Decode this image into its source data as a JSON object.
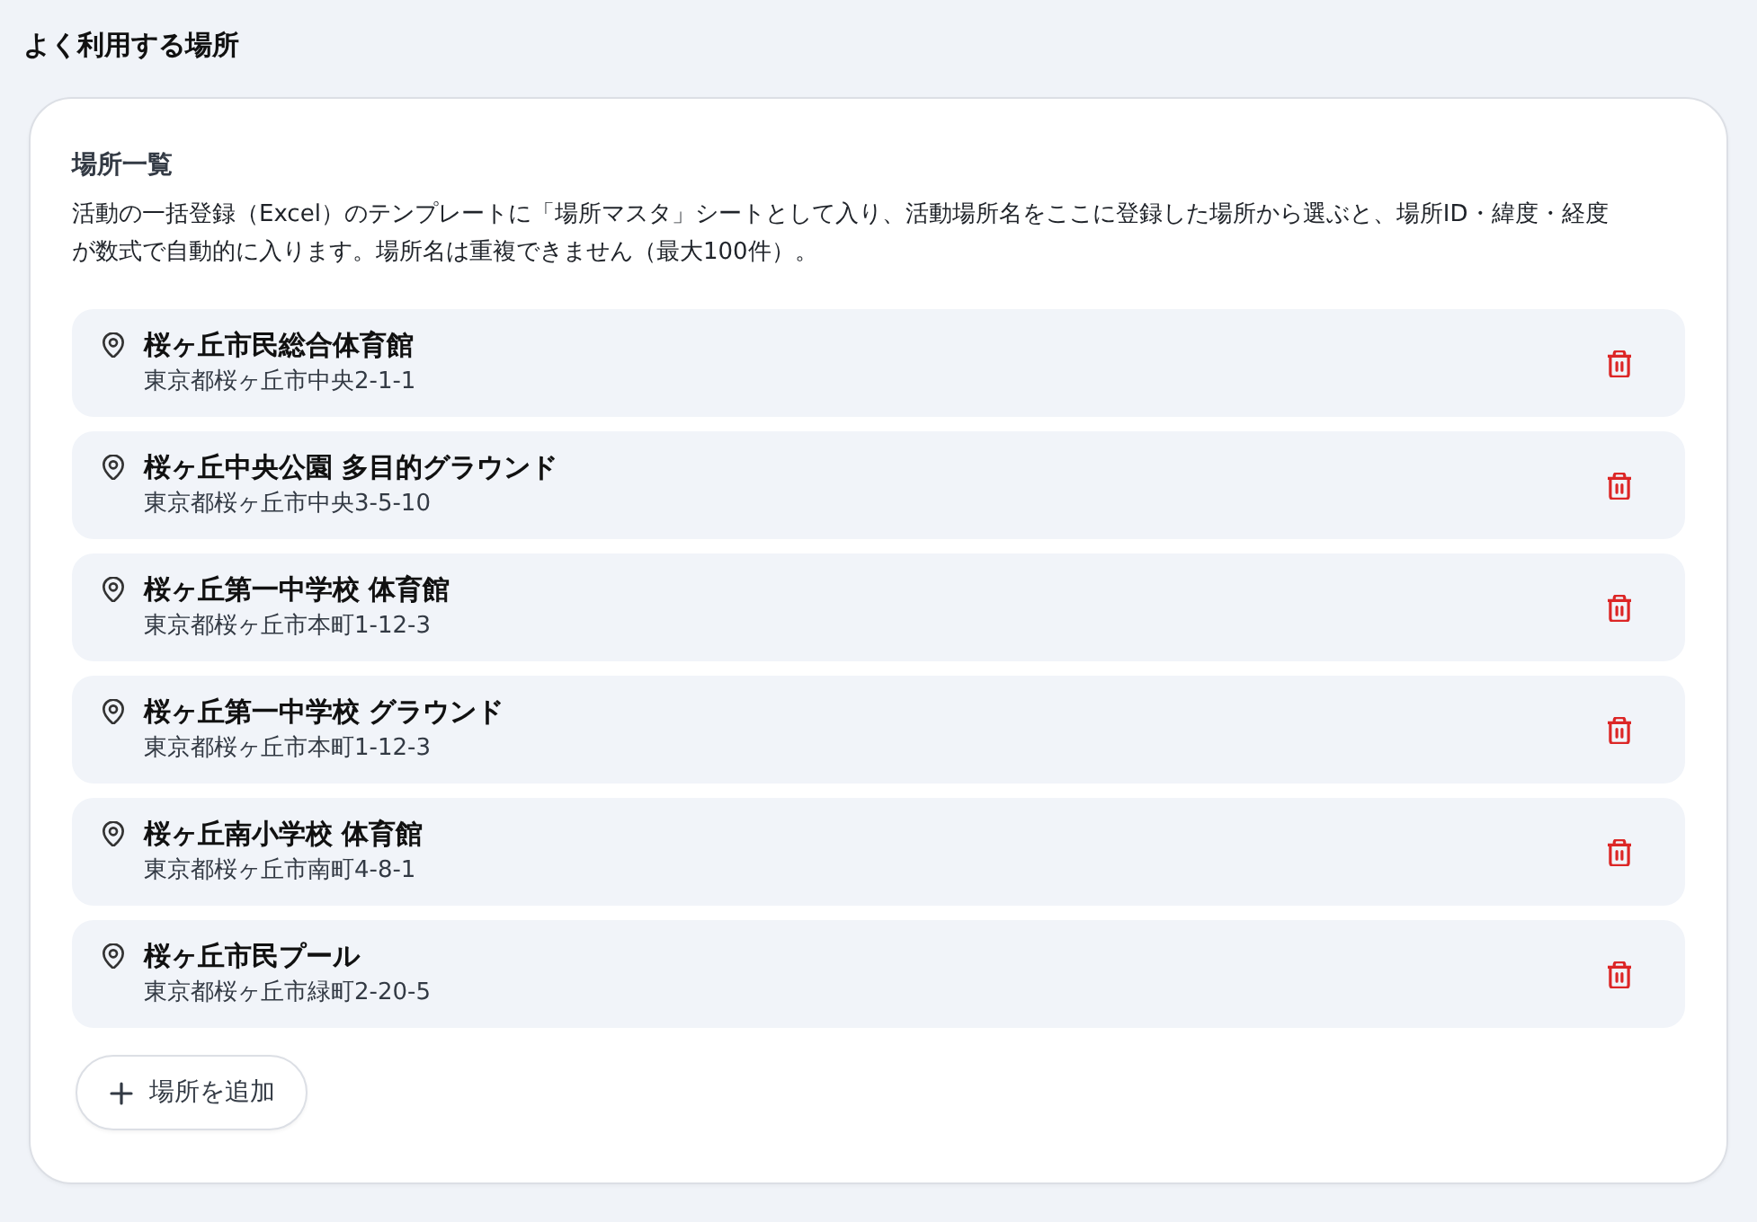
{
  "heading": "よく利用する場所",
  "panel": {
    "title": "場所一覧",
    "description": "活動の一括登録（Excel）のテンプレートに「場所マスタ」シートとして入り、活動場所名をここに登録した場所から選ぶと、場所ID・緯度・経度が数式で自動的に入ります。場所名は重複できません（最大100件）。",
    "places": [
      {
        "name": "桜ヶ丘市民総合体育館",
        "address": "東京都桜ヶ丘市中央2-1-1"
      },
      {
        "name": "桜ヶ丘中央公園 多目的グラウンド",
        "address": "東京都桜ヶ丘市中央3-5-10"
      },
      {
        "name": "桜ヶ丘第一中学校 体育館",
        "address": "東京都桜ヶ丘市本町1-12-3"
      },
      {
        "name": "桜ヶ丘第一中学校 グラウンド",
        "address": "東京都桜ヶ丘市本町1-12-3"
      },
      {
        "name": "桜ヶ丘南小学校 体育館",
        "address": "東京都桜ヶ丘市南町4-8-1"
      },
      {
        "name": "桜ヶ丘市民プール",
        "address": "東京都桜ヶ丘市緑町2-20-5"
      }
    ],
    "add_button": "場所を追加"
  }
}
